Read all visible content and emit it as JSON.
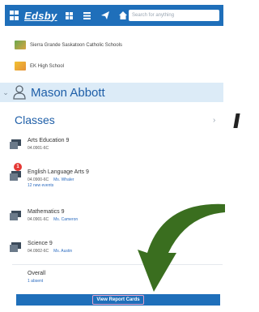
{
  "nav": {
    "logo": "Edsby",
    "search_placeholder": "Search for anything"
  },
  "schools": [
    "Sierra Grande Saskatoon Catholic Schools",
    "EK High School"
  ],
  "student": {
    "name": "Mason Abbott"
  },
  "classes_heading": "Classes",
  "classes": [
    {
      "title": "Arts Education 9",
      "code": "04.0901-6C",
      "teacher": "",
      "extra": "",
      "badge": ""
    },
    {
      "title": "English Language Arts 9",
      "code": "04.0900-6C",
      "teacher": "Ms. Whaler",
      "extra": "12 new events",
      "badge": "1"
    },
    {
      "title": "Mathematics 9",
      "code": "04.0901-6C",
      "teacher": "Ms. Cameron",
      "extra": "",
      "badge": ""
    },
    {
      "title": "Science 9",
      "code": "04.0902-6C",
      "teacher": "Ms. Austin",
      "extra": "",
      "badge": ""
    }
  ],
  "overall": {
    "label": "Overall",
    "value": "1 absent"
  },
  "report_button": "View Report Cards",
  "colors": {
    "nav_blue": "#1f6fba",
    "student_bar": "#dcebf7",
    "link_blue": "#1f5fa8",
    "badge_red": "#e53935",
    "arrow_green": "#3a6e1f"
  }
}
